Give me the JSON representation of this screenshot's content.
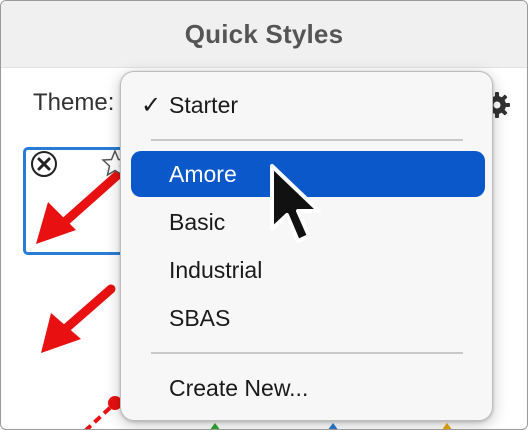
{
  "window": {
    "title": "Quick Styles"
  },
  "theme_selector": {
    "label": "Theme:"
  },
  "menu": {
    "items": [
      {
        "label": "Starter",
        "checked": true
      },
      {
        "label": "Amore",
        "highlighted": true
      },
      {
        "label": "Basic"
      },
      {
        "label": "Industrial"
      },
      {
        "label": "SBAS"
      },
      {
        "label": "Create New..."
      }
    ],
    "check_glyph": "✓"
  },
  "icons": {
    "gear": "gear-icon",
    "close": "close-icon",
    "star": "star-icon",
    "cursor": "arrow-cursor"
  },
  "colors": {
    "highlight": "#0a58c9",
    "tile_border": "#2a7bd4",
    "arrow_red": "#e81010",
    "title_text": "#555555"
  }
}
